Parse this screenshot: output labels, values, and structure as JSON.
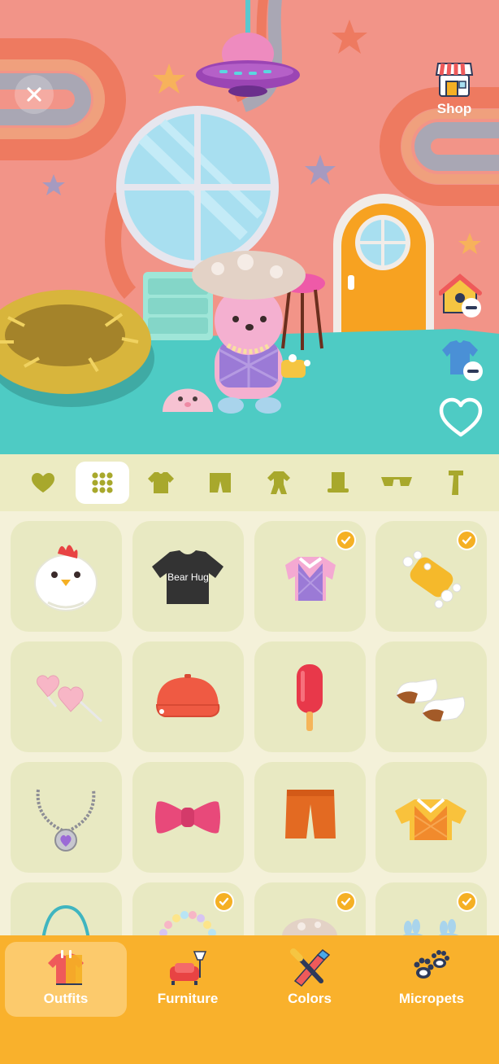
{
  "scene": {
    "shop_label": "Shop",
    "close_icon": "close-icon",
    "favorite_icon": "heart-outline-icon",
    "remove_furniture_icon": "house-minus-icon",
    "remove_outfit_icon": "shirt-minus-icon"
  },
  "categories": [
    {
      "name": "favorites",
      "icon": "heart-icon",
      "active": false
    },
    {
      "name": "all",
      "icon": "grid-icon",
      "active": true
    },
    {
      "name": "tops",
      "icon": "shirt-icon",
      "active": false
    },
    {
      "name": "bottoms",
      "icon": "pants-icon",
      "active": false
    },
    {
      "name": "full-body",
      "icon": "onesie-icon",
      "active": false
    },
    {
      "name": "hats",
      "icon": "top-hat-icon",
      "active": false
    },
    {
      "name": "glasses",
      "icon": "sunglasses-icon",
      "active": false
    },
    {
      "name": "accessories",
      "icon": "scarf-icon",
      "active": false
    }
  ],
  "items": [
    {
      "name": "chicken-hat",
      "equipped": false
    },
    {
      "name": "bear-hug-tshirt",
      "text": "Bear Hug",
      "equipped": false
    },
    {
      "name": "purple-plaid-vest",
      "equipped": true
    },
    {
      "name": "bubble-sponge",
      "equipped": true
    },
    {
      "name": "heart-glasses",
      "equipped": false
    },
    {
      "name": "red-cap",
      "equipped": false
    },
    {
      "name": "popsicle",
      "equipped": false
    },
    {
      "name": "brown-shoes",
      "equipped": false
    },
    {
      "name": "heart-necklace",
      "equipped": false
    },
    {
      "name": "pink-bow",
      "equipped": false
    },
    {
      "name": "orange-shorts",
      "equipped": false
    },
    {
      "name": "orange-plaid-vest",
      "equipped": false
    },
    {
      "name": "teal-bag",
      "equipped": false
    },
    {
      "name": "bead-bracelet",
      "equipped": true
    },
    {
      "name": "mushroom-hat",
      "equipped": true
    },
    {
      "name": "bunny-slippers",
      "equipped": true
    }
  ],
  "bottom_nav": [
    {
      "label": "Outfits",
      "icon": "outfits-icon",
      "active": true
    },
    {
      "label": "Furniture",
      "icon": "sofa-lamp-icon",
      "active": false
    },
    {
      "label": "Colors",
      "icon": "paintbrush-icon",
      "active": false
    },
    {
      "label": "Micropets",
      "icon": "paw-icon",
      "active": false
    }
  ],
  "colors": {
    "wall": "#f29488",
    "floor": "#4ecbc4",
    "accent": "#f9b12c",
    "tile": "#e8e9c2",
    "category_icon": "#a8a82c"
  }
}
